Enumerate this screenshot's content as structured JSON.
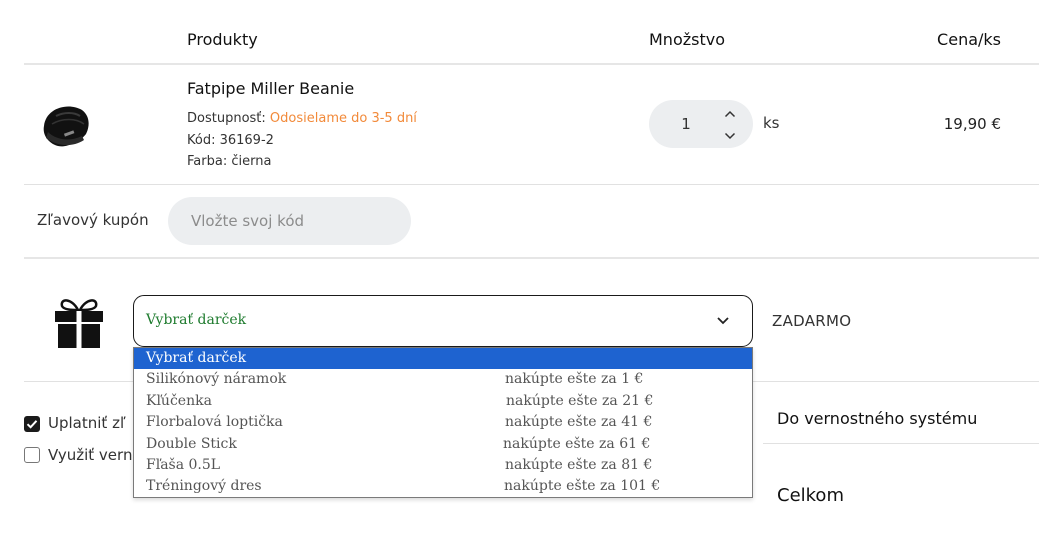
{
  "header": {
    "products": "Produkty",
    "quantity": "Množstvo",
    "price_per_unit": "Cena/ks"
  },
  "product": {
    "name": "Fatpipe Miller Beanie",
    "availability_label": "Dostupnosť:",
    "availability_value": "Odosielame do 3-5 dní",
    "code": "Kód: 36169-2",
    "color": "Farba: čierna",
    "quantity": "1",
    "unit": "ks",
    "price": "19,90 €"
  },
  "coupon": {
    "label": "Zľavový kupón",
    "placeholder": "Vložte svoj kód"
  },
  "gift": {
    "selected": "Vybrať darček",
    "price_label": "ZADARMO",
    "options": [
      {
        "name": "Vybrať darček",
        "note": ""
      },
      {
        "name": "Silikónový náramok",
        "note": "nakúpte ešte za 1 €"
      },
      {
        "name": "Kľúčenka",
        "note": "nakúpte ešte za 21 €"
      },
      {
        "name": "Florbalová loptička",
        "note": "nakúpte ešte za 41 €"
      },
      {
        "name": "Double Stick",
        "note": "nakúpte ešte za 61 €"
      },
      {
        "name": "Fľaša 0.5L",
        "note": "nakúpte ešte za 81 €"
      },
      {
        "name": "Tréningový dres",
        "note": "nakúpte ešte za 101 €"
      }
    ]
  },
  "options_bottom": {
    "apply_discount": "Uplatniť zľ",
    "apply_discount_checked": true,
    "use_loyalty": "Využiť vern",
    "use_loyalty_checked": false
  },
  "summary": {
    "loyalty": "Do vernostného systému",
    "total": "Celkom"
  },
  "colors": {
    "accent_orange": "#f28a3a",
    "select_text_green": "#1e7b2e",
    "dropdown_selected": "#1e63d0"
  },
  "icons": [
    "beanie-product-image",
    "chevron-up-icon",
    "chevron-down-icon",
    "gift-icon",
    "checkbox-checked-icon",
    "checkbox-empty-icon"
  ]
}
